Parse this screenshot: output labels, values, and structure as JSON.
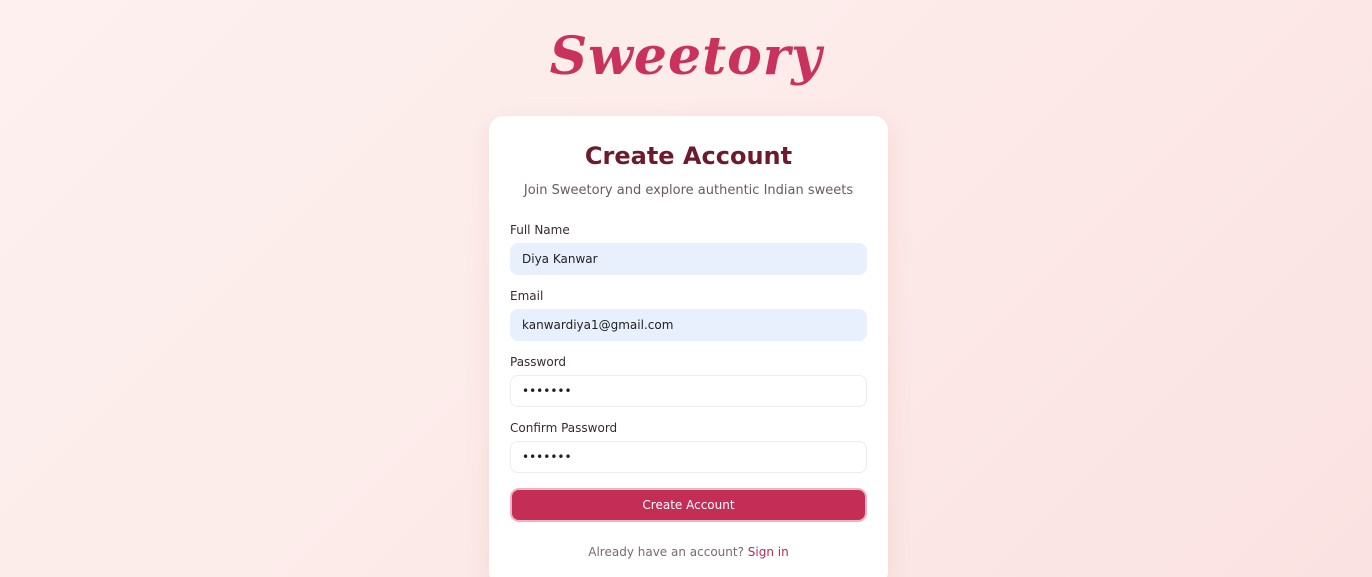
{
  "brand": {
    "logo_text": "Sweetory"
  },
  "colors": {
    "brand": "#c8325c",
    "title": "#6e1a2e",
    "button": "#c42d56",
    "link": "#b22b52"
  },
  "form": {
    "title": "Create Account",
    "subtitle": "Join Sweetory and explore authentic Indian sweets",
    "fields": {
      "full_name": {
        "label": "Full Name",
        "value": "Diya Kanwar"
      },
      "email": {
        "label": "Email",
        "value": "kanwardiya1@gmail.com"
      },
      "password": {
        "label": "Password",
        "value": "•••••••"
      },
      "confirm_password": {
        "label": "Confirm Password",
        "value": "•••••••"
      }
    },
    "submit_label": "Create Account",
    "signin_prompt": "Already have an account?",
    "signin_link": "Sign in"
  }
}
